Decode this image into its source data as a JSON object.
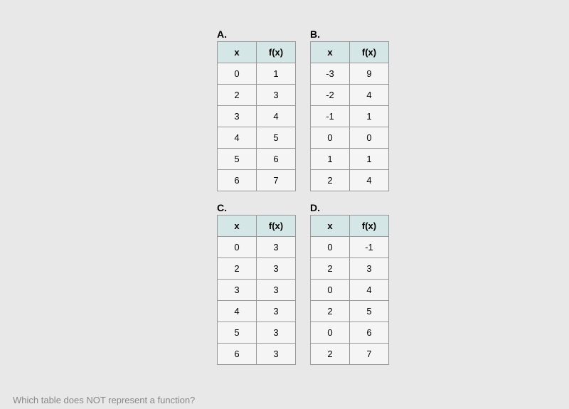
{
  "tables": {
    "A": {
      "label": "A.",
      "headers": [
        "x",
        "f(x)"
      ],
      "rows": [
        [
          "0",
          "1"
        ],
        [
          "2",
          "3"
        ],
        [
          "3",
          "4"
        ],
        [
          "4",
          "5"
        ],
        [
          "5",
          "6"
        ],
        [
          "6",
          "7"
        ]
      ]
    },
    "B": {
      "label": "B.",
      "headers": [
        "x",
        "f(x)"
      ],
      "rows": [
        [
          "-3",
          "9"
        ],
        [
          "-2",
          "4"
        ],
        [
          "-1",
          "1"
        ],
        [
          "0",
          "0"
        ],
        [
          "1",
          "1"
        ],
        [
          "2",
          "4"
        ]
      ]
    },
    "C": {
      "label": "C.",
      "headers": [
        "x",
        "f(x)"
      ],
      "rows": [
        [
          "0",
          "3"
        ],
        [
          "2",
          "3"
        ],
        [
          "3",
          "3"
        ],
        [
          "4",
          "3"
        ],
        [
          "5",
          "3"
        ],
        [
          "6",
          "3"
        ]
      ]
    },
    "D": {
      "label": "D.",
      "headers": [
        "x",
        "f(x)"
      ],
      "rows": [
        [
          "0",
          "-1"
        ],
        [
          "2",
          "3"
        ],
        [
          "0",
          "4"
        ],
        [
          "2",
          "5"
        ],
        [
          "0",
          "6"
        ],
        [
          "2",
          "7"
        ]
      ]
    }
  },
  "question": "Which table does NOT represent a function?"
}
